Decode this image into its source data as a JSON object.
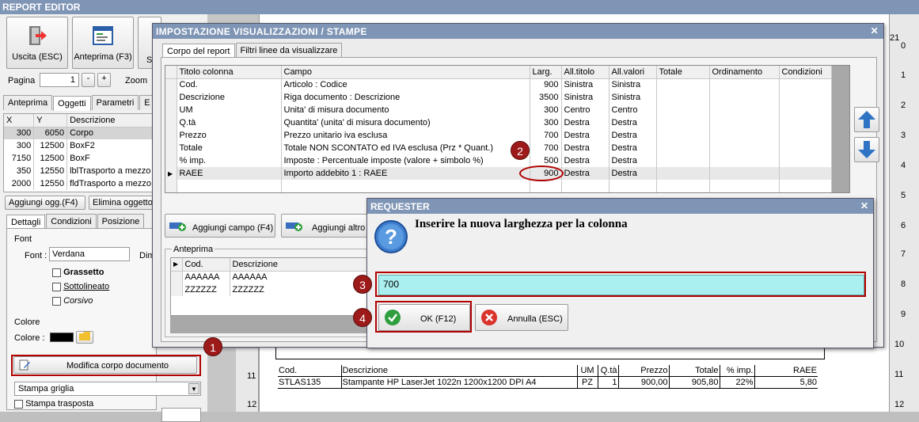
{
  "app": {
    "title": "REPORT EDITOR"
  },
  "toolbar": {
    "exit_label": "Uscita (ESC)",
    "preview_label": "Anteprima (F3)",
    "third_label": "S"
  },
  "paging": {
    "label": "Pagina",
    "value": "1",
    "minus": "-",
    "plus": "+",
    "zoom_label": "Zoom"
  },
  "left_tabs": [
    "Anteprima",
    "Oggetti",
    "Parametri",
    "E"
  ],
  "objects": {
    "headers": [
      "X",
      "Y",
      "Descrizione"
    ],
    "rows": [
      [
        "300",
        "6050",
        "Corpo"
      ],
      [
        "300",
        "12500",
        "BoxF2"
      ],
      [
        "7150",
        "12500",
        "BoxF"
      ],
      [
        "350",
        "12550",
        "lblTrasporto a mezzo"
      ],
      [
        "2000",
        "12550",
        "fldTrasporto a mezzo"
      ]
    ]
  },
  "object_buttons": {
    "add": "Aggiungi ogg.(F4)",
    "delete": "Elimina oggetto"
  },
  "detail_tabs": [
    "Dettagli",
    "Condizioni",
    "Posizione"
  ],
  "font": {
    "group": "Font",
    "label": "Font :",
    "value": "Verdana",
    "dim": "Dim",
    "bold": "Grassetto",
    "underline": "Sottolineato",
    "italic": "Corsivo"
  },
  "color": {
    "group": "Colore",
    "label": "Colore :"
  },
  "modify_body_label": "Modifica corpo documento",
  "print_grid": "Stampa griglia",
  "print_transparent": "Stampa trasposta",
  "settings_dialog": {
    "title": "IMPOSTAZIONE VISUALIZZAZIONI / STAMPE",
    "tabs": [
      "Corpo del report",
      "Filtri linee da visualizzare"
    ],
    "headers": [
      "Titolo colonna",
      "Campo",
      "Larg.",
      "All.titolo",
      "All.valori",
      "Totale",
      "Ordinamento",
      "Condizioni"
    ],
    "rows": [
      [
        "Cod.",
        "Articolo : Codice",
        "900",
        "Sinistra",
        "Sinistra"
      ],
      [
        "Descrizione",
        "Riga documento : Descrizione",
        "3500",
        "Sinistra",
        "Sinistra"
      ],
      [
        "UM",
        "Unita' di misura documento",
        "300",
        "Centro",
        "Centro"
      ],
      [
        "Q.tà",
        "Quantita' (unita' di misura documento)",
        "300",
        "Destra",
        "Destra"
      ],
      [
        "Prezzo",
        "Prezzo unitario iva esclusa",
        "700",
        "Destra",
        "Destra"
      ],
      [
        "Totale",
        "Totale NON SCONTATO ed IVA esclusa (Prz * Quant.)",
        "700",
        "Destra",
        "Destra"
      ],
      [
        "% imp.",
        "Imposte : Percentuale imposte (valore + simbolo %)",
        "500",
        "Destra",
        "Destra"
      ],
      [
        "RAEE",
        "Importo addebito 1 : RAEE",
        "900",
        "Destra",
        "Destra"
      ]
    ],
    "add_field": "Aggiungi campo (F4)",
    "add_other": "Aggiungi altro",
    "preview_group": "Anteprima",
    "preview_headers": [
      "Cod.",
      "Descrizione"
    ],
    "preview_rows": [
      [
        "AAAAAA",
        "AAAAAA"
      ],
      [
        "ZZZZZZ",
        "ZZZZZZ"
      ]
    ]
  },
  "requester": {
    "title": "REQUESTER",
    "message": "Inserire la nuova larghezza per la colonna",
    "value": "700",
    "ok": "OK (F12)",
    "cancel": "Annulla (ESC)"
  },
  "document": {
    "headers": [
      "Cod.",
      "Descrizione",
      "UM",
      "Q.tà",
      "Prezzo",
      "Totale",
      "% imp.",
      "RAEE"
    ],
    "row": [
      "STLAS135",
      "Stampante HP LaserJet 1022n 1200x1200 DPI A4",
      "PZ",
      "1",
      "900,00",
      "905,80",
      "22%",
      "5,80"
    ]
  },
  "ruler": {
    "right": [
      "0",
      "1",
      "2",
      "3",
      "4",
      "5",
      "6",
      "7",
      "8",
      "9",
      "10",
      "11",
      "12"
    ],
    "top": "21",
    "left": [
      "11",
      "12"
    ]
  },
  "badges": [
    "1",
    "2",
    "3",
    "4"
  ],
  "colors": {
    "title_bar": "#7f95b5",
    "highlight": "#b00000",
    "input_bg": "#aaf0f0",
    "ok_green": "#2e9e3e",
    "cancel_red": "#d9342b",
    "arrow_blue": "#2f73c4"
  }
}
